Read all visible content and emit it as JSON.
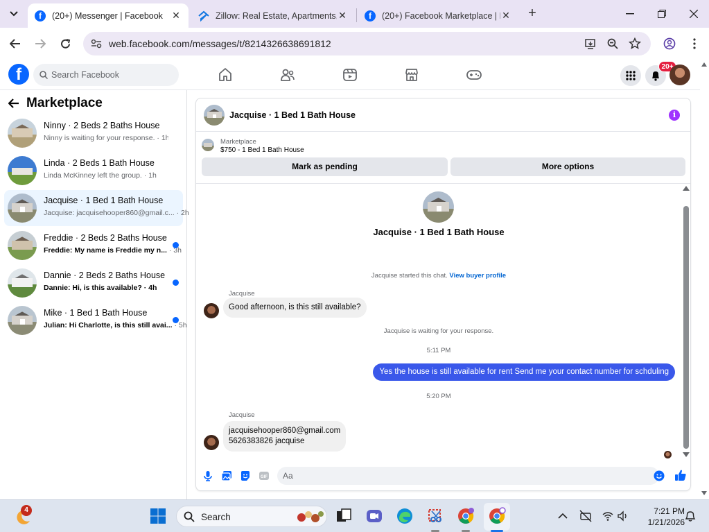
{
  "browser": {
    "tabs": [
      {
        "title": "(20+) Messenger | Facebook",
        "active": true,
        "favicon": "facebook-icon"
      },
      {
        "title": "Zillow: Real Estate, Apartments,",
        "active": false,
        "favicon": "zillow-icon"
      },
      {
        "title": "(20+) Facebook Marketplace | F",
        "active": false,
        "favicon": "facebook-icon"
      }
    ],
    "url": "web.facebook.com/messages/t/8214326638691812"
  },
  "fb": {
    "search_placeholder": "Search Facebook",
    "notification_count": "20+",
    "accent": "#0866ff"
  },
  "sidebar": {
    "title": "Marketplace",
    "conversations": [
      {
        "name": "Ninny · 2 Beds 2 Baths House",
        "preview": "Ninny is waiting for your response. · 1h",
        "unread": false,
        "active": false
      },
      {
        "name": "Linda · 2 Beds 1 Bath House",
        "preview": "Linda McKinney left the group. · 1h",
        "unread": false,
        "active": false
      },
      {
        "name": "Jacquise · 1 Bed 1 Bath House",
        "preview": "Jacquise: jacquisehooper860@gmail.c...",
        "time": "· 2h",
        "unread": false,
        "active": true
      },
      {
        "name": "Freddie · 2 Beds 2 Baths House",
        "preview": "Freddie: My name is Freddie my n...",
        "time": "· 3h",
        "unread": true,
        "active": false
      },
      {
        "name": "Dannie · 2 Beds 2 Baths House",
        "preview": "Dannie: Hi, is this available? · 4h",
        "unread": true,
        "active": false
      },
      {
        "name": "Mike · 1 Bed 1 Bath House",
        "preview": "Julian: Hi Charlotte, is this still avai...",
        "time": "· 5h",
        "unread": true,
        "active": false
      }
    ]
  },
  "chat": {
    "title": "Jacquise · 1 Bed 1 Bath House",
    "listing_label": "Marketplace",
    "listing_desc": "$750 - 1 Bed 1 Bath House",
    "mark_pending": "Mark as pending",
    "more_options": "More options",
    "intro_title": "Jacquise · 1 Bed 1 Bath House",
    "started_text": "Jacquise started this chat.",
    "view_profile": "View buyer profile",
    "messages": [
      {
        "sender": "Jacquise",
        "text": "Good afternoon, is this still available?"
      },
      {
        "system": "Jacquise is waiting for your response."
      },
      {
        "time": "5:11 PM"
      },
      {
        "out": "Yes the house is still available for rent Send me your contact number for schduling"
      },
      {
        "time": "5:20 PM"
      },
      {
        "sender": "Jacquise",
        "line1": "jacquisehooper860@gmail.com",
        "line2": "5626383826 jacquise"
      }
    ],
    "composer_placeholder": "Aa",
    "outgoing_color": "#3a58ea"
  },
  "taskbar": {
    "search_label": "Search",
    "widget_badge": "4",
    "time": "7:21 PM",
    "date": "1/21/2026"
  }
}
